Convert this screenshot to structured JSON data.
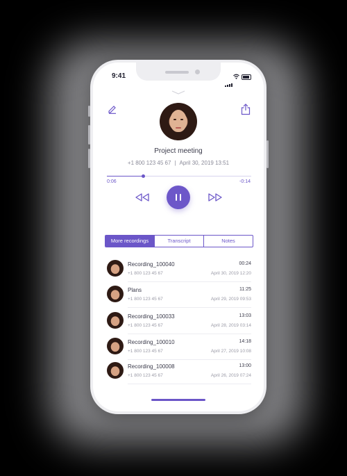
{
  "status_bar": {
    "time": "9:41"
  },
  "header": {
    "title": "Project meeting",
    "phone": "+1 800 123 45 67",
    "datetime": "April 30, 2019  13:51"
  },
  "player": {
    "elapsed": "0:06",
    "remaining": "-0:14",
    "progress": 0.25,
    "state": "playing"
  },
  "tabs": [
    {
      "label": "More recordings",
      "active": true
    },
    {
      "label": "Transcript",
      "active": false
    },
    {
      "label": "Notes",
      "active": false
    }
  ],
  "recordings": [
    {
      "name": "Recording_100040",
      "phone": "+1 800 123 45 67",
      "duration": "00:24",
      "date": "April 30, 2019  12:20"
    },
    {
      "name": "Plans",
      "phone": "+1 800 123 45 67",
      "duration": "11:25",
      "date": "April 29, 2019  09:53"
    },
    {
      "name": "Recording_100033",
      "phone": "+1 800 123 45 67",
      "duration": "13:03",
      "date": "April 28, 2019  03:14"
    },
    {
      "name": "Recording_100010",
      "phone": "+1 800 123 45 67",
      "duration": "14:18",
      "date": "April 27, 2019  10:08"
    },
    {
      "name": "Recording_100008",
      "phone": "+1 800 123 45 67",
      "duration": "13:00",
      "date": "April 26, 2019  07:24"
    }
  ],
  "colors": {
    "accent": "#6b56c8",
    "text": "#3a3a4a",
    "muted": "#9a9aa6"
  },
  "icons": [
    "edit-icon",
    "share-icon",
    "chevron-down-icon",
    "rewind-icon",
    "pause-icon",
    "fast-forward-icon",
    "signal-icon",
    "wifi-icon",
    "battery-icon"
  ]
}
